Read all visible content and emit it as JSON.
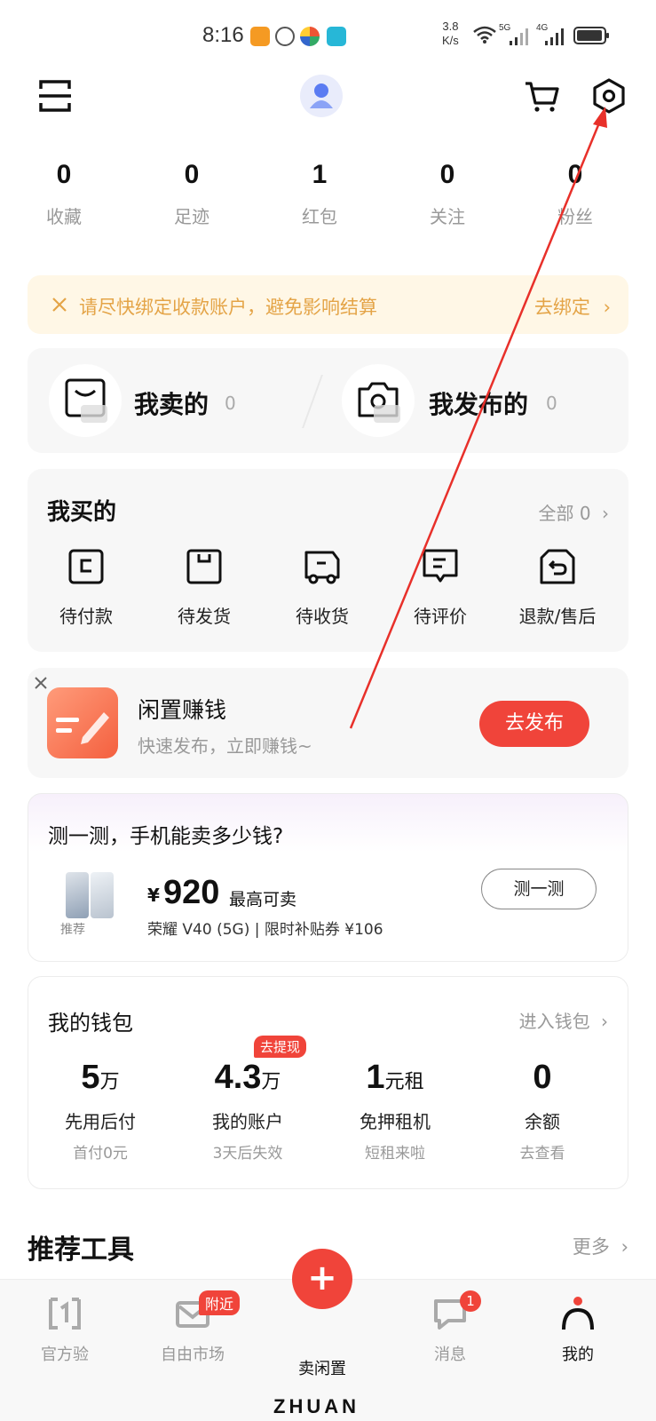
{
  "status_bar": {
    "time": "8:16",
    "net_speed_value": "3.8",
    "net_speed_unit": "K/s",
    "signal_1": "5G",
    "signal_2": "4G"
  },
  "header": {
    "scan_icon": "scan-icon",
    "cart_icon": "cart-icon",
    "settings_icon": "settings-hexagon-icon"
  },
  "stats": [
    {
      "value": "0",
      "label": "收藏"
    },
    {
      "value": "0",
      "label": "足迹"
    },
    {
      "value": "1",
      "label": "红包"
    },
    {
      "value": "0",
      "label": "关注"
    },
    {
      "value": "0",
      "label": "粉丝"
    }
  ],
  "notice": {
    "text": "请尽快绑定收款账户，避免影响结算",
    "link": "去绑定"
  },
  "sell": {
    "sold_label": "我卖的",
    "sold_count": "0",
    "published_label": "我发布的",
    "published_count": "0"
  },
  "buy": {
    "title": "我买的",
    "all_label": "全部 0",
    "items": [
      {
        "label": "待付款"
      },
      {
        "label": "待发货"
      },
      {
        "label": "待收货"
      },
      {
        "label": "待评价"
      },
      {
        "label": "退款/售后"
      }
    ]
  },
  "promo": {
    "title": "闲置赚钱",
    "subtitle": "快速发布，立即赚钱~",
    "button": "去发布"
  },
  "estimate": {
    "title": "测一测，手机能卖多少钱?",
    "currency": "¥",
    "price": "920",
    "price_note": "最高可卖",
    "model": "荣耀 V40 (5G) | 限时补贴券 ¥106",
    "tag": "推荐",
    "button": "测一测"
  },
  "wallet": {
    "title": "我的钱包",
    "enter": "进入钱包",
    "items": [
      {
        "value": "5",
        "unit": "万",
        "label": "先用后付",
        "sub": "首付0元"
      },
      {
        "value": "4.3",
        "unit": "万",
        "label": "我的账户",
        "sub": "3天后失效",
        "badge": "去提现"
      },
      {
        "value": "1",
        "unit": "元租",
        "label": "免押租机",
        "sub": "短租来啦"
      },
      {
        "value": "0",
        "unit": "",
        "label": "余额",
        "sub": "去查看"
      }
    ]
  },
  "tools": {
    "title": "推荐工具",
    "more": "更多"
  },
  "tabbar": {
    "items": [
      {
        "label": "官方验"
      },
      {
        "label": "自由市场",
        "badge": "附近"
      },
      {
        "label": "卖闲置"
      },
      {
        "label": "消息",
        "badge": "1"
      },
      {
        "label": "我的"
      }
    ],
    "brand": "ZHUAN"
  },
  "colors": {
    "accent": "#f0443a",
    "notice_text": "#e4a447",
    "notice_bg": "#fff7e6"
  }
}
